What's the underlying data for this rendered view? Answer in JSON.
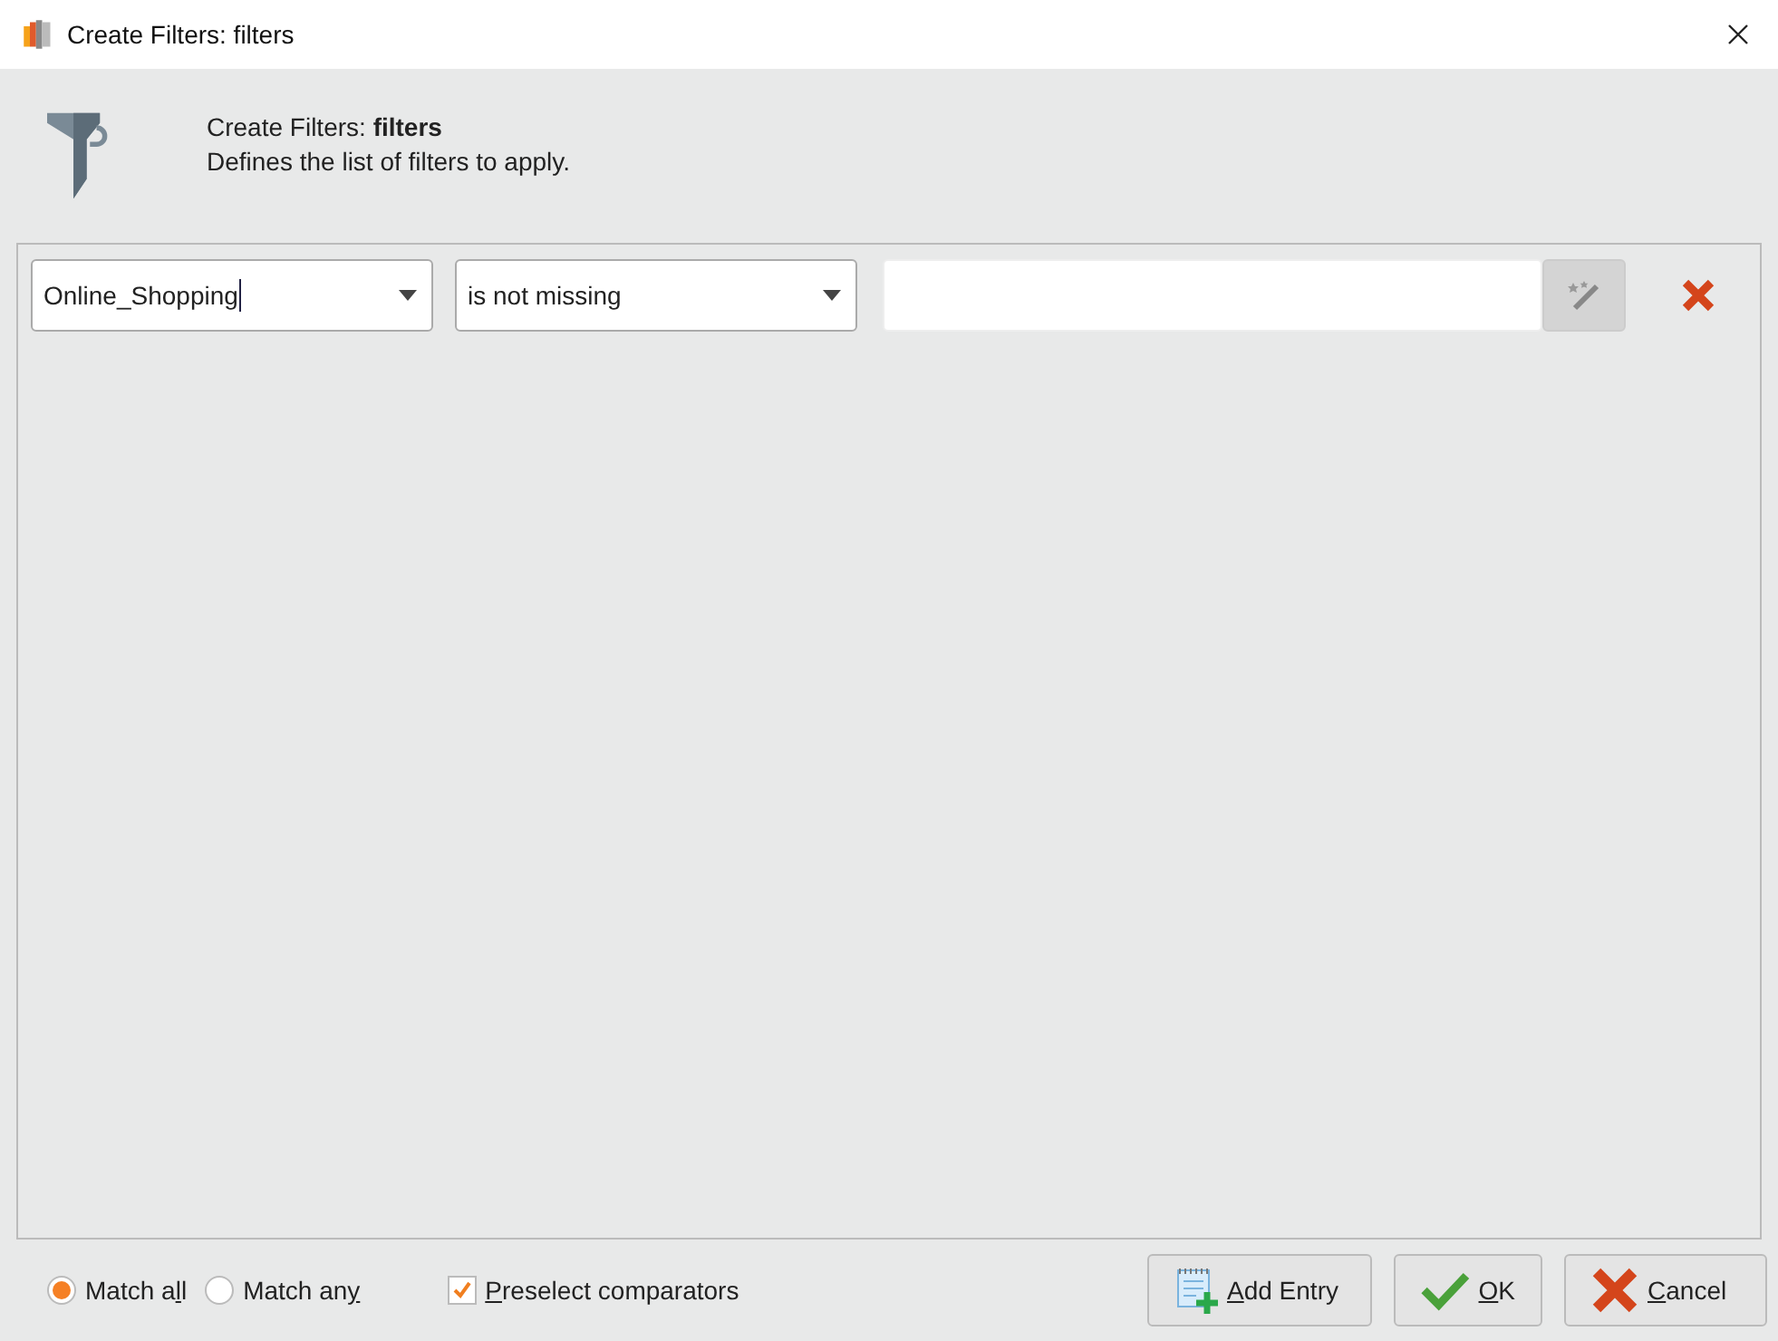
{
  "window": {
    "title": "Create Filters: filters"
  },
  "header": {
    "title": "Create Filters: **filters**",
    "description": "Defines the list of filters to apply."
  },
  "filters": [
    {
      "attribute": "Online_Shopping",
      "comparator": "is not missing"
    }
  ],
  "match_options": [
    {
      "label": {
        "before": "Match a",
        "key": "l",
        "after": "l"
      },
      "selected": true
    },
    {
      "label": {
        "before": "Match an",
        "key": "y"
      },
      "selected": false
    }
  ],
  "preselect": {
    "label": {
      "key": "P",
      "after": "reselect comparators"
    },
    "checked": true
  },
  "buttons": [
    {
      "kind": "add",
      "label": {
        "key": "A",
        "after": "dd Entry"
      }
    },
    {
      "kind": "ok",
      "label": {
        "key": "O",
        "after": "K"
      }
    },
    {
      "kind": "cancel",
      "label": {
        "key": "C",
        "after": "ancel"
      }
    }
  ]
}
